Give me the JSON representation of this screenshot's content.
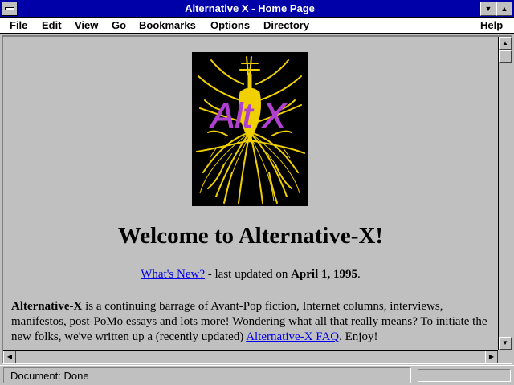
{
  "window": {
    "title": "Alternative X - Home Page"
  },
  "menubar": {
    "file": "File",
    "edit": "Edit",
    "view": "View",
    "go": "Go",
    "bookmarks": "Bookmarks",
    "options": "Options",
    "directory": "Directory",
    "help": "Help"
  },
  "logo": {
    "text": "Alt X",
    "text_color": "#b040d0",
    "burst_color": "#f0d000",
    "background": "#000000"
  },
  "page": {
    "heading": "Welcome to Alternative-X!",
    "whats_new_link": "What's New?",
    "updated_prefix": " - last updated on ",
    "updated_date": "April 1, 1995",
    "updated_suffix": ".",
    "intro_bold": "Alternative-X",
    "intro_text": " is a continuing barrage of Avant-Pop fiction, Internet columns, interviews, manifestos, post-PoMo essays and lots more! Wondering what all that really means? To initiate the new folks, we've written up a (recently updated) ",
    "faq_link": "Alternative-X FAQ",
    "intro_end": ". Enjoy!"
  },
  "statusbar": {
    "text": "Document: Done"
  },
  "colors": {
    "titlebar": "#0000a8",
    "chrome": "#c0c0c0",
    "link": "#0000ee"
  }
}
